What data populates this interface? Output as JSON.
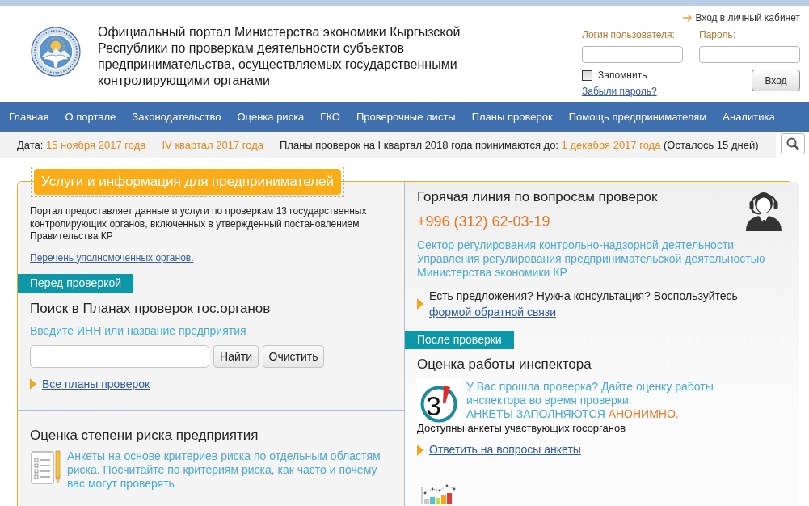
{
  "header": {
    "title": "Официальный портал Министерства экономики Кыргызской Республики по проверкам деятельности субъектов предпринимательства, осуществляемых государственными контролирующими органами",
    "cabinet_link": "Вход в личный кабинет",
    "login": {
      "username_label": "Логин пользователя:",
      "password_label": "Пароль:",
      "remember_label": "Запомнить",
      "remember_checked": false,
      "forgot_link": "Забыли пароль?",
      "submit_button": "Вход"
    }
  },
  "nav": {
    "items": [
      {
        "label": "Главная"
      },
      {
        "label": "О портале"
      },
      {
        "label": "Законодательство"
      },
      {
        "label": "Оценка риска"
      },
      {
        "label": "ГКО"
      },
      {
        "label": "Проверочные листы"
      },
      {
        "label": "Планы проверок"
      },
      {
        "label": "Помощь предпринимателям"
      },
      {
        "label": "Аналитика"
      }
    ]
  },
  "info_bar": {
    "date_label": "Дата:",
    "date": "15 ноября 2017 года",
    "quarter": "IV квартал 2017 года",
    "deadline_label": "Планы проверок на I квартал 2018 года принимаются до:",
    "deadline_date": "1 декабря 2017 года",
    "remaining": "(Осталось 15 дней)"
  },
  "services": {
    "title": "Услуги и информация для предпринимателей",
    "intro": "Портал предоставляет данные и услуги по проверкам 13 государственных контролирующих органов, включенных в утвержденный постановлением Правительства КР",
    "authorities_link": "Перечень уполномоченных органов.",
    "before": {
      "tag": "Перед проверкой",
      "heading": "Поиск в Планах проверок гос.органов",
      "hint": "Введите ИНН или название предприятия",
      "find_button": "Найти",
      "clear_button": "Очистить",
      "all_plans_link": "Все планы проверок"
    },
    "risk": {
      "heading": "Оценка степени риска предприятия",
      "text": "Анкеты на основе критериев риска по отдельным областям риска. Посчитайте по критериям риска, как часто и почему вас могут проверять"
    },
    "hotline": {
      "heading": "Горячая линия по вопросам проверок",
      "phone": "+996 (312) 62-03-19",
      "department": "Сектор регулирования контрольно-надзорной деятельности Управления регулирования предпринимательской деятельностью Министерства экономики КР",
      "suggestion": "Есть предложения? Нужна консультация? Воспользуйтесь",
      "feedback_link": "формой обратной связи"
    },
    "after": {
      "tag": "После проверки",
      "heading": "Оценка работы инспектора",
      "score_icon_digit": "3",
      "prompt": "У Вас прошла проверка? Дайте оценку работы инспектора во время проверки.",
      "anonymous_note": "АНКЕТЫ ЗАПОЛНЯЮТСЯ",
      "anonymous_highlight": "АНОНИМНО.",
      "available": "Доступны анкеты участвующих госорганов",
      "survey_link": "Ответить на вопросы анкеты"
    }
  }
}
